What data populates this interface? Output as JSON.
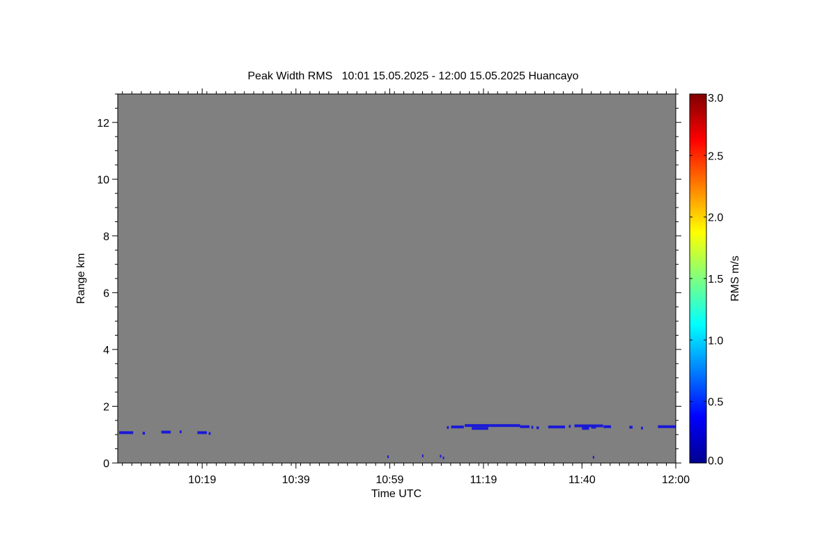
{
  "chart_data": {
    "type": "heatmap",
    "title": "Peak Width RMS   10:01 15.05.2025 - 12:00 15.05.2025 Huancayo",
    "xlabel": "Time UTC",
    "ylabel": "Range km",
    "colorbar_label": "RMS m/s",
    "xlim_minutes": [
      601,
      720
    ],
    "x_ticks": [
      {
        "label": "10:19",
        "minutes": 619
      },
      {
        "label": "10:39",
        "minutes": 639
      },
      {
        "label": "10:59",
        "minutes": 659
      },
      {
        "label": "11:19",
        "minutes": 679
      },
      {
        "label": "11:40",
        "minutes": 700
      },
      {
        "label": "12:00",
        "minutes": 720
      }
    ],
    "ylim": [
      0,
      13
    ],
    "y_ticks": [
      "0",
      "2",
      "4",
      "6",
      "8",
      "10",
      "12"
    ],
    "colorbar_range": [
      0,
      3
    ],
    "colorbar_ticks": [
      "0.0",
      "0.5",
      "1.0",
      "1.5",
      "2.0",
      "2.5",
      "3.0"
    ],
    "colormap": "jet",
    "no_data_color": "#808080",
    "data_color": "#1a1ad6",
    "echoes": [
      {
        "t0": 601.3,
        "t1": 604.3,
        "range": 1.07,
        "rms": 0.1
      },
      {
        "t0": 606.3,
        "t1": 606.8,
        "range": 1.05,
        "rms": 0.1
      },
      {
        "t0": 610.3,
        "t1": 612.3,
        "range": 1.09,
        "rms": 0.1
      },
      {
        "t0": 614.2,
        "t1": 614.6,
        "range": 1.1,
        "rms": 0.1
      },
      {
        "t0": 618.0,
        "t1": 620.0,
        "range": 1.07,
        "rms": 0.1
      },
      {
        "t0": 620.4,
        "t1": 620.8,
        "range": 1.04,
        "rms": 0.1
      },
      {
        "t0": 658.5,
        "t1": 658.8,
        "range": 0.22,
        "rms": 0.1
      },
      {
        "t0": 665.9,
        "t1": 666.2,
        "range": 0.25,
        "rms": 0.1
      },
      {
        "t0": 669.7,
        "t1": 669.9,
        "range": 0.24,
        "rms": 0.1
      },
      {
        "t0": 670.3,
        "t1": 670.5,
        "range": 0.18,
        "rms": 0.1
      },
      {
        "t0": 671.2,
        "t1": 671.6,
        "range": 1.25,
        "rms": 0.1
      },
      {
        "t0": 672.1,
        "t1": 674.8,
        "range": 1.27,
        "rms": 0.1
      },
      {
        "t0": 675.0,
        "t1": 686.8,
        "range": 1.32,
        "rms": 0.1
      },
      {
        "t0": 676.5,
        "t1": 680.0,
        "range": 1.22,
        "rms": 0.1
      },
      {
        "t0": 686.8,
        "t1": 688.8,
        "range": 1.28,
        "rms": 0.1
      },
      {
        "t0": 689.2,
        "t1": 689.6,
        "range": 1.26,
        "rms": 0.1
      },
      {
        "t0": 690.3,
        "t1": 690.8,
        "range": 1.24,
        "rms": 0.1
      },
      {
        "t0": 692.8,
        "t1": 696.4,
        "range": 1.27,
        "rms": 0.1
      },
      {
        "t0": 697.2,
        "t1": 697.6,
        "range": 1.29,
        "rms": 0.1
      },
      {
        "t0": 698.4,
        "t1": 704.5,
        "range": 1.31,
        "rms": 0.1
      },
      {
        "t0": 700.0,
        "t1": 701.5,
        "range": 1.22,
        "rms": 0.1
      },
      {
        "t0": 702.0,
        "t1": 703.0,
        "range": 1.26,
        "rms": 0.1
      },
      {
        "t0": 702.3,
        "t1": 702.6,
        "range": 0.2,
        "rms": 0.1
      },
      {
        "t0": 704.6,
        "t1": 706.2,
        "range": 1.28,
        "rms": 0.1
      },
      {
        "t0": 710.1,
        "t1": 710.8,
        "range": 1.26,
        "rms": 0.1
      },
      {
        "t0": 712.6,
        "t1": 713.0,
        "range": 1.23,
        "rms": 0.1
      },
      {
        "t0": 716.2,
        "t1": 720.0,
        "range": 1.28,
        "rms": 0.1
      }
    ]
  }
}
